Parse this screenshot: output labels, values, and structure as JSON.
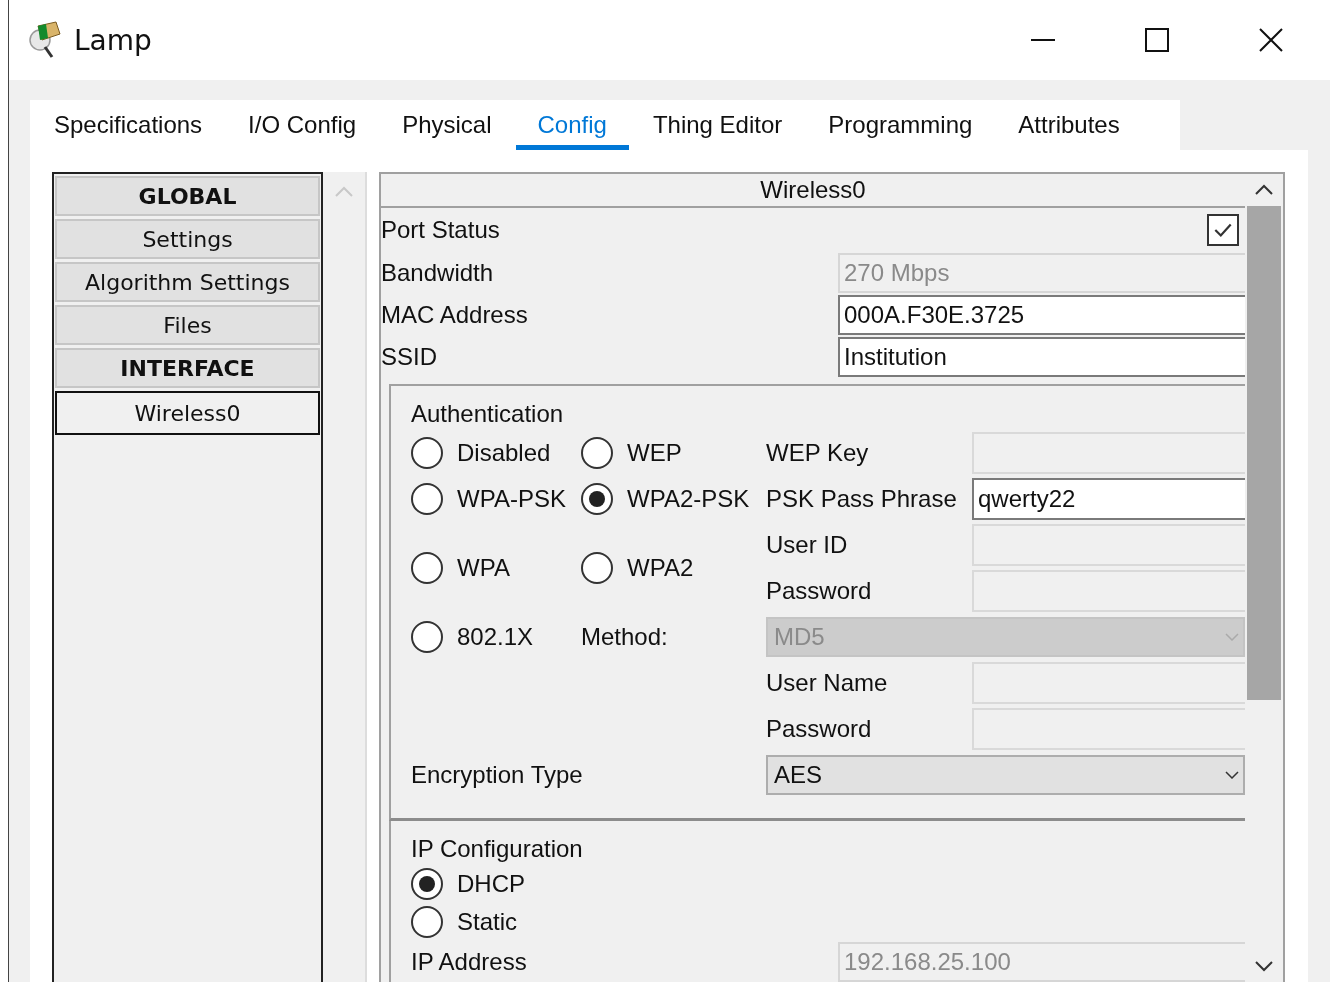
{
  "window": {
    "title": "Lamp"
  },
  "tabs": [
    {
      "label": "Specifications",
      "selected": false
    },
    {
      "label": "I/O Config",
      "selected": false
    },
    {
      "label": "Physical",
      "selected": false
    },
    {
      "label": "Config",
      "selected": true
    },
    {
      "label": "Thing Editor",
      "selected": false
    },
    {
      "label": "Programming",
      "selected": false
    },
    {
      "label": "Attributes",
      "selected": false
    }
  ],
  "sidebar": {
    "items": [
      {
        "label": "GLOBAL",
        "kind": "header",
        "selected": false
      },
      {
        "label": "Settings",
        "kind": "item",
        "selected": false
      },
      {
        "label": "Algorithm Settings",
        "kind": "item",
        "selected": false
      },
      {
        "label": "Files",
        "kind": "item",
        "selected": false
      },
      {
        "label": "INTERFACE",
        "kind": "header",
        "selected": false
      },
      {
        "label": "Wireless0",
        "kind": "item",
        "selected": true
      }
    ]
  },
  "panel": {
    "title": "Wireless0",
    "port_status": {
      "label": "Port Status",
      "checked": true
    },
    "fields": [
      {
        "label": "Bandwidth",
        "value": "270 Mbps",
        "disabled": true
      },
      {
        "label": "MAC Address",
        "value": "000A.F30E.3725",
        "disabled": false
      },
      {
        "label": "SSID",
        "value": "Institution",
        "disabled": false
      }
    ],
    "authentication": {
      "title": "Authentication",
      "options": [
        {
          "label": "Disabled",
          "selected": false
        },
        {
          "label": "WEP",
          "selected": false
        },
        {
          "label": "WPA-PSK",
          "selected": false
        },
        {
          "label": "WPA2-PSK",
          "selected": true
        },
        {
          "label": "WPA",
          "selected": false
        },
        {
          "label": "WPA2",
          "selected": false
        },
        {
          "label": "802.1X",
          "selected": false
        }
      ],
      "fields": [
        {
          "label": "WEP Key",
          "kind": "text",
          "disabled": true
        },
        {
          "label": "PSK Pass Phrase",
          "kind": "text",
          "value": "qwerty22",
          "disabled": false
        },
        {
          "label": "User ID",
          "kind": "text",
          "disabled": true
        },
        {
          "label": "Password",
          "kind": "text",
          "disabled": true
        },
        {
          "label": "Method:",
          "kind": "select",
          "value": "MD5",
          "disabled": true
        },
        {
          "label": "User Name",
          "kind": "text",
          "disabled": true
        },
        {
          "label": "Password",
          "kind": "text",
          "disabled": true
        },
        {
          "label": "Encryption Type",
          "kind": "select",
          "value": "AES",
          "disabled": false
        }
      ]
    },
    "ip_configuration": {
      "title": "IP Configuration",
      "options": [
        {
          "label": "DHCP",
          "selected": true
        },
        {
          "label": "Static",
          "selected": false
        }
      ],
      "fields": [
        {
          "label": "IP Address",
          "value": "192.168.25.100",
          "disabled": true
        }
      ]
    }
  }
}
